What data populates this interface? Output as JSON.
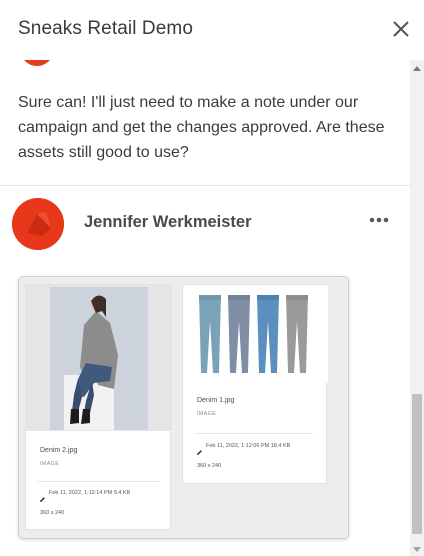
{
  "header": {
    "title": "Sneaks Retail Demo",
    "close_icon": "close-icon"
  },
  "previous_message": {
    "text": "Sure can! I'll just need to make a note under our campaign and get the changes approved. Are these assets still good to use?"
  },
  "comment": {
    "author": "Jennifer Werkmeister",
    "avatar_color": "#e8371a",
    "more_icon": "more-options-icon",
    "attachments": [
      {
        "name": "Denim 2.jpg",
        "type": "IMAGE",
        "meta": "Feb 11, 2022, 1:12:14 PM  9.4 KB",
        "dims": "360 x 240"
      },
      {
        "name": "Denim 1.jpg",
        "type": "IMAGE",
        "meta": "Feb 11, 2022, 1:12:06 PM  18.4 KB",
        "dims": "360 x 240"
      }
    ]
  },
  "colors": {
    "accent": "#e8371a",
    "text": "#3b3b3b",
    "attachment_bg": "#ededed"
  }
}
